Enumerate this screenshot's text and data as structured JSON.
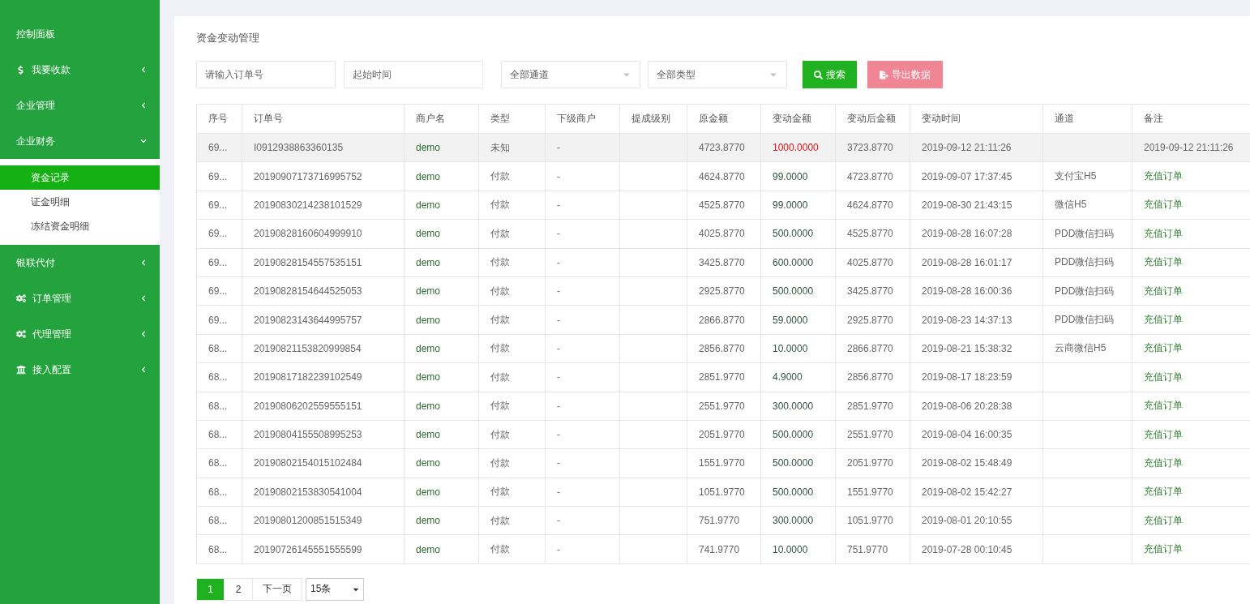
{
  "sidebar": {
    "items": [
      {
        "label": "控制面板",
        "kind": "plain"
      },
      {
        "label": "我要收款",
        "kind": "dollar",
        "expanded": false
      },
      {
        "label": "企业管理",
        "kind": "plain",
        "expanded": false
      },
      {
        "label": "企业财务",
        "kind": "plain",
        "expanded": true,
        "children": [
          {
            "label": "资金记录",
            "selected": true
          },
          {
            "label": "证金明细",
            "selected": false
          },
          {
            "label": "冻结资金明细",
            "selected": false
          }
        ]
      },
      {
        "label": "银联代付",
        "kind": "plain",
        "expanded": false
      },
      {
        "label": "订单管理",
        "kind": "gears",
        "expanded": false
      },
      {
        "label": "代理管理",
        "kind": "gears",
        "expanded": false
      },
      {
        "label": "接入配置",
        "kind": "bank",
        "expanded": false
      }
    ]
  },
  "page_title": "资金变动管理",
  "filters": [
    {
      "kind": "input",
      "placeholder": "请输入订单号"
    },
    {
      "kind": "input",
      "placeholder": "起始时间"
    },
    {
      "kind": "select",
      "value": "全部通道"
    },
    {
      "kind": "select",
      "value": "全部类型"
    },
    {
      "kind": "search",
      "label": "搜索"
    },
    {
      "kind": "export",
      "label": "导出数据"
    }
  ],
  "table": {
    "columns": [
      "序号",
      "订单号",
      "商户名",
      "类型",
      "下级商户",
      "提成级别",
      "原金额",
      "变动金额",
      "变动后金额",
      "变动时间",
      "通道",
      "备注"
    ],
    "rows": [
      {
        "cells": [
          "69...",
          "I0912938863360135",
          "demo",
          "未知",
          "-",
          "",
          "4723.8770",
          "1000.0000",
          "3723.8770",
          "2019-09-12 21:11:26",
          "",
          "2019-09-12 21:11:26"
        ],
        "hovered": true,
        "flagged": true
      },
      {
        "cells": [
          "69...",
          "20190907173716995752",
          "demo",
          "付款",
          "-",
          "",
          "4624.8770",
          "99.0000",
          "4723.8770",
          "2019-09-07 17:37:45",
          "支付宝H5",
          "充值订单"
        ],
        "hovered": false,
        "flagged": false
      },
      {
        "cells": [
          "69...",
          "20190830214238101529",
          "demo",
          "付款",
          "-",
          "",
          "4525.8770",
          "99.0000",
          "4624.8770",
          "2019-08-30 21:43:15",
          "微信H5",
          "充值订单"
        ],
        "hovered": false,
        "flagged": false
      },
      {
        "cells": [
          "69...",
          "20190828160604999910",
          "demo",
          "付款",
          "-",
          "",
          "4025.8770",
          "500.0000",
          "4525.8770",
          "2019-08-28 16:07:28",
          "PDD微信扫码",
          "充值订单"
        ],
        "hovered": false,
        "flagged": false
      },
      {
        "cells": [
          "69...",
          "20190828154557535151",
          "demo",
          "付款",
          "-",
          "",
          "3425.8770",
          "600.0000",
          "4025.8770",
          "2019-08-28 16:01:17",
          "PDD微信扫码",
          "充值订单"
        ],
        "hovered": false,
        "flagged": false
      },
      {
        "cells": [
          "69...",
          "20190828154644525053",
          "demo",
          "付款",
          "-",
          "",
          "2925.8770",
          "500.0000",
          "3425.8770",
          "2019-08-28 16:00:36",
          "PDD微信扫码",
          "充值订单"
        ],
        "hovered": false,
        "flagged": false
      },
      {
        "cells": [
          "69...",
          "20190823143644995757",
          "demo",
          "付款",
          "-",
          "",
          "2866.8770",
          "59.0000",
          "2925.8770",
          "2019-08-23 14:37:13",
          "PDD微信扫码",
          "充值订单"
        ],
        "hovered": false,
        "flagged": false
      },
      {
        "cells": [
          "68...",
          "20190821153820999854",
          "demo",
          "付款",
          "-",
          "",
          "2856.8770",
          "10.0000",
          "2866.8770",
          "2019-08-21 15:38:32",
          "云商微信H5",
          "充值订单"
        ],
        "hovered": false,
        "flagged": false
      },
      {
        "cells": [
          "68...",
          "20190817182239102549",
          "demo",
          "付款",
          "-",
          "",
          "2851.9770",
          "4.9000",
          "2856.8770",
          "2019-08-17 18:23:59",
          "",
          "充值订单"
        ],
        "hovered": false,
        "flagged": false
      },
      {
        "cells": [
          "68...",
          "20190806202559555151",
          "demo",
          "付款",
          "-",
          "",
          "2551.9770",
          "300.0000",
          "2851.9770",
          "2019-08-06 20:28:38",
          "",
          "充值订单"
        ],
        "hovered": false,
        "flagged": false
      },
      {
        "cells": [
          "68...",
          "20190804155508995253",
          "demo",
          "付款",
          "-",
          "",
          "2051.9770",
          "500.0000",
          "2551.9770",
          "2019-08-04 16:00:35",
          "",
          "充值订单"
        ],
        "hovered": false,
        "flagged": false
      },
      {
        "cells": [
          "68...",
          "20190802154015102484",
          "demo",
          "付款",
          "-",
          "",
          "1551.9770",
          "500.0000",
          "2051.9770",
          "2019-08-02 15:48:49",
          "",
          "充值订单"
        ],
        "hovered": false,
        "flagged": false
      },
      {
        "cells": [
          "68...",
          "20190802153830541004",
          "demo",
          "付款",
          "-",
          "",
          "1051.9770",
          "500.0000",
          "1551.9770",
          "2019-08-02 15:42:27",
          "",
          "充值订单"
        ],
        "hovered": false,
        "flagged": false
      },
      {
        "cells": [
          "68...",
          "20190801200851515349",
          "demo",
          "付款",
          "-",
          "",
          "751.9770",
          "300.0000",
          "1051.9770",
          "2019-08-01 20:10:55",
          "",
          "充值订单"
        ],
        "hovered": false,
        "flagged": false
      },
      {
        "cells": [
          "68...",
          "20190726145551555599",
          "demo",
          "付款",
          "-",
          "",
          "741.9770",
          "10.0000",
          "751.9770",
          "2019-07-28 00:10:45",
          "",
          "充值订单"
        ],
        "hovered": false,
        "flagged": false
      }
    ]
  },
  "pagination": {
    "pages": [
      {
        "label": "1",
        "selected": true
      },
      {
        "label": "2",
        "selected": false
      }
    ],
    "next": "下一页",
    "page_size": "15条"
  }
}
